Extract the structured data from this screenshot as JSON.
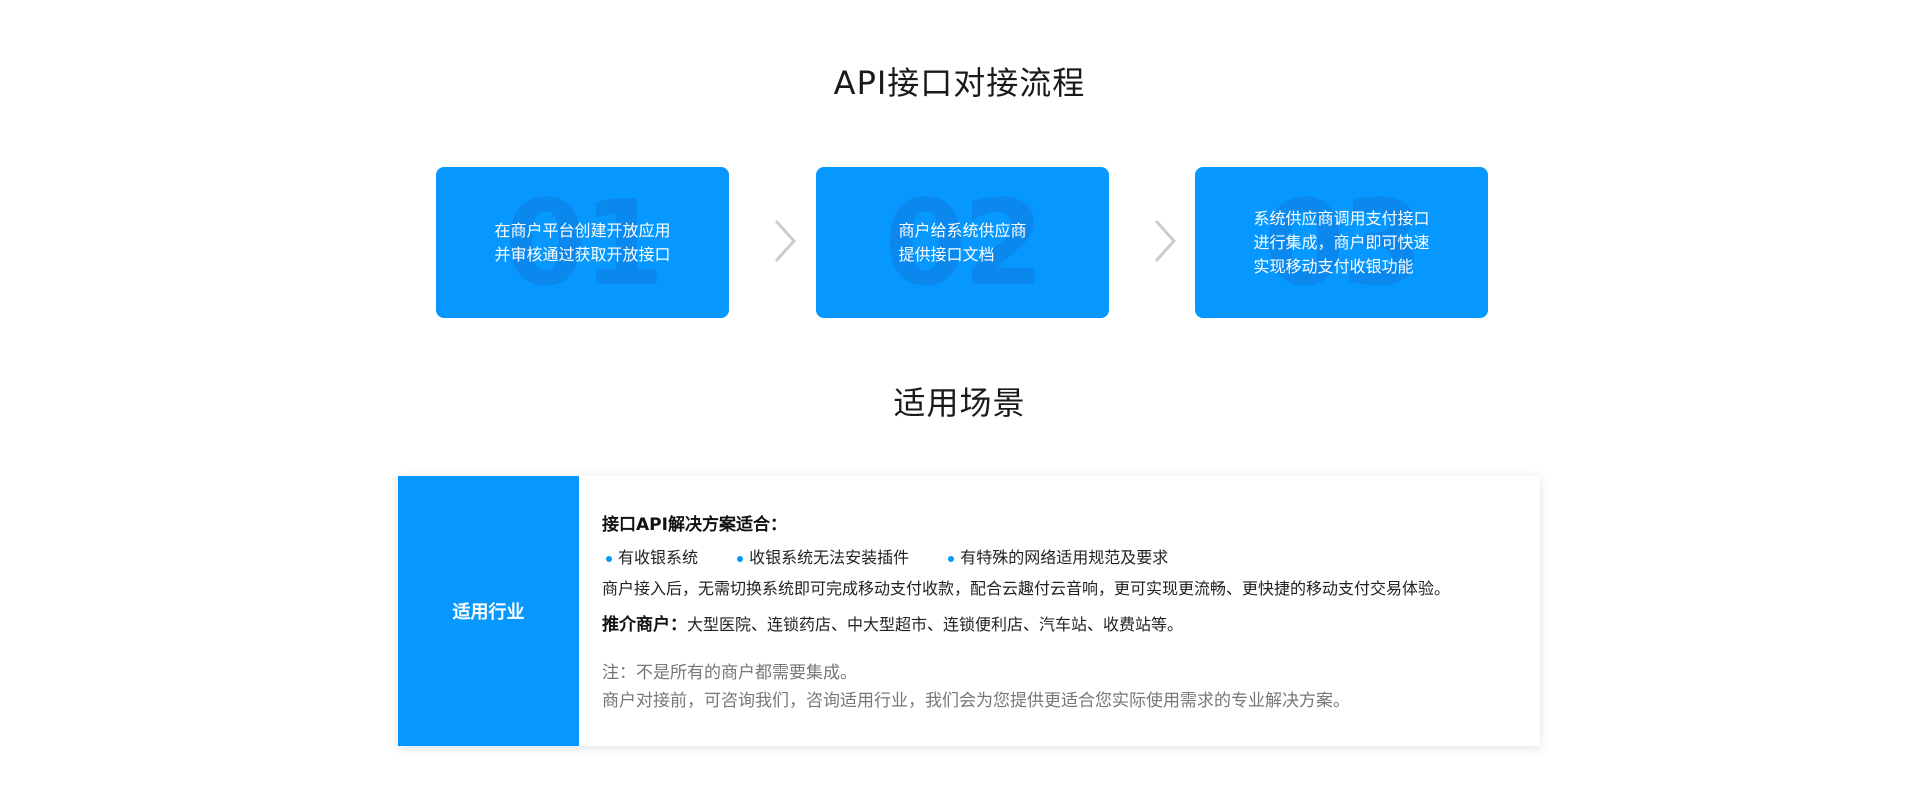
{
  "flow": {
    "title": "API接口对接流程",
    "steps": [
      {
        "num": "01",
        "lines": [
          "在商户平台创建开放应用",
          "并审核通过获取开放接口"
        ]
      },
      {
        "num": "02",
        "lines": [
          "商户给系统供应商",
          "提供接口文档"
        ]
      },
      {
        "num": "03",
        "lines": [
          "系统供应商调用支付接口",
          "进行集成，商户即可快速",
          "实现移动支付收银功能"
        ]
      }
    ]
  },
  "scene": {
    "title": "适用场景",
    "side_label": "适用行业",
    "heading": "接口API解决方案适合：",
    "bullets": [
      "有收银系统",
      "收银系统无法安装插件",
      "有特殊的网络适用规范及要求"
    ],
    "description": "商户接入后，无需切换系统即可完成移动支付收款，配合云趣付云音响，更可实现更流畅、更快捷的移动支付交易体验。",
    "recommend_label": "推介商户：",
    "recommend_text": "大型医院、连锁药店、中大型超市、连锁便利店、汽车站、收费站等。",
    "note_line1": "注：不是所有的商户都需要集成。",
    "note_line2": "商户对接前，可咨询我们，咨询适用行业，我们会为您提供更适合您实际使用需求的专业解决方案。"
  },
  "colors": {
    "accent": "#0698ff",
    "chevron": "#cccccc"
  }
}
